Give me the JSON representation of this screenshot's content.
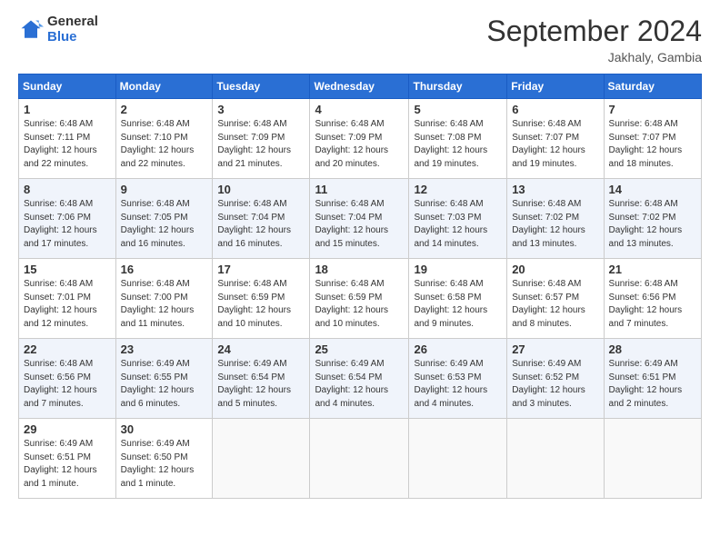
{
  "header": {
    "logo_general": "General",
    "logo_blue": "Blue",
    "month_title": "September 2024",
    "location": "Jakhaly, Gambia"
  },
  "weekdays": [
    "Sunday",
    "Monday",
    "Tuesday",
    "Wednesday",
    "Thursday",
    "Friday",
    "Saturday"
  ],
  "weeks": [
    [
      {
        "day": "1",
        "sunrise": "Sunrise: 6:48 AM",
        "sunset": "Sunset: 7:11 PM",
        "daylight": "Daylight: 12 hours and 22 minutes."
      },
      {
        "day": "2",
        "sunrise": "Sunrise: 6:48 AM",
        "sunset": "Sunset: 7:10 PM",
        "daylight": "Daylight: 12 hours and 22 minutes."
      },
      {
        "day": "3",
        "sunrise": "Sunrise: 6:48 AM",
        "sunset": "Sunset: 7:09 PM",
        "daylight": "Daylight: 12 hours and 21 minutes."
      },
      {
        "day": "4",
        "sunrise": "Sunrise: 6:48 AM",
        "sunset": "Sunset: 7:09 PM",
        "daylight": "Daylight: 12 hours and 20 minutes."
      },
      {
        "day": "5",
        "sunrise": "Sunrise: 6:48 AM",
        "sunset": "Sunset: 7:08 PM",
        "daylight": "Daylight: 12 hours and 19 minutes."
      },
      {
        "day": "6",
        "sunrise": "Sunrise: 6:48 AM",
        "sunset": "Sunset: 7:07 PM",
        "daylight": "Daylight: 12 hours and 19 minutes."
      },
      {
        "day": "7",
        "sunrise": "Sunrise: 6:48 AM",
        "sunset": "Sunset: 7:07 PM",
        "daylight": "Daylight: 12 hours and 18 minutes."
      }
    ],
    [
      {
        "day": "8",
        "sunrise": "Sunrise: 6:48 AM",
        "sunset": "Sunset: 7:06 PM",
        "daylight": "Daylight: 12 hours and 17 minutes."
      },
      {
        "day": "9",
        "sunrise": "Sunrise: 6:48 AM",
        "sunset": "Sunset: 7:05 PM",
        "daylight": "Daylight: 12 hours and 16 minutes."
      },
      {
        "day": "10",
        "sunrise": "Sunrise: 6:48 AM",
        "sunset": "Sunset: 7:04 PM",
        "daylight": "Daylight: 12 hours and 16 minutes."
      },
      {
        "day": "11",
        "sunrise": "Sunrise: 6:48 AM",
        "sunset": "Sunset: 7:04 PM",
        "daylight": "Daylight: 12 hours and 15 minutes."
      },
      {
        "day": "12",
        "sunrise": "Sunrise: 6:48 AM",
        "sunset": "Sunset: 7:03 PM",
        "daylight": "Daylight: 12 hours and 14 minutes."
      },
      {
        "day": "13",
        "sunrise": "Sunrise: 6:48 AM",
        "sunset": "Sunset: 7:02 PM",
        "daylight": "Daylight: 12 hours and 13 minutes."
      },
      {
        "day": "14",
        "sunrise": "Sunrise: 6:48 AM",
        "sunset": "Sunset: 7:02 PM",
        "daylight": "Daylight: 12 hours and 13 minutes."
      }
    ],
    [
      {
        "day": "15",
        "sunrise": "Sunrise: 6:48 AM",
        "sunset": "Sunset: 7:01 PM",
        "daylight": "Daylight: 12 hours and 12 minutes."
      },
      {
        "day": "16",
        "sunrise": "Sunrise: 6:48 AM",
        "sunset": "Sunset: 7:00 PM",
        "daylight": "Daylight: 12 hours and 11 minutes."
      },
      {
        "day": "17",
        "sunrise": "Sunrise: 6:48 AM",
        "sunset": "Sunset: 6:59 PM",
        "daylight": "Daylight: 12 hours and 10 minutes."
      },
      {
        "day": "18",
        "sunrise": "Sunrise: 6:48 AM",
        "sunset": "Sunset: 6:59 PM",
        "daylight": "Daylight: 12 hours and 10 minutes."
      },
      {
        "day": "19",
        "sunrise": "Sunrise: 6:48 AM",
        "sunset": "Sunset: 6:58 PM",
        "daylight": "Daylight: 12 hours and 9 minutes."
      },
      {
        "day": "20",
        "sunrise": "Sunrise: 6:48 AM",
        "sunset": "Sunset: 6:57 PM",
        "daylight": "Daylight: 12 hours and 8 minutes."
      },
      {
        "day": "21",
        "sunrise": "Sunrise: 6:48 AM",
        "sunset": "Sunset: 6:56 PM",
        "daylight": "Daylight: 12 hours and 7 minutes."
      }
    ],
    [
      {
        "day": "22",
        "sunrise": "Sunrise: 6:48 AM",
        "sunset": "Sunset: 6:56 PM",
        "daylight": "Daylight: 12 hours and 7 minutes."
      },
      {
        "day": "23",
        "sunrise": "Sunrise: 6:49 AM",
        "sunset": "Sunset: 6:55 PM",
        "daylight": "Daylight: 12 hours and 6 minutes."
      },
      {
        "day": "24",
        "sunrise": "Sunrise: 6:49 AM",
        "sunset": "Sunset: 6:54 PM",
        "daylight": "Daylight: 12 hours and 5 minutes."
      },
      {
        "day": "25",
        "sunrise": "Sunrise: 6:49 AM",
        "sunset": "Sunset: 6:54 PM",
        "daylight": "Daylight: 12 hours and 4 minutes."
      },
      {
        "day": "26",
        "sunrise": "Sunrise: 6:49 AM",
        "sunset": "Sunset: 6:53 PM",
        "daylight": "Daylight: 12 hours and 4 minutes."
      },
      {
        "day": "27",
        "sunrise": "Sunrise: 6:49 AM",
        "sunset": "Sunset: 6:52 PM",
        "daylight": "Daylight: 12 hours and 3 minutes."
      },
      {
        "day": "28",
        "sunrise": "Sunrise: 6:49 AM",
        "sunset": "Sunset: 6:51 PM",
        "daylight": "Daylight: 12 hours and 2 minutes."
      }
    ],
    [
      {
        "day": "29",
        "sunrise": "Sunrise: 6:49 AM",
        "sunset": "Sunset: 6:51 PM",
        "daylight": "Daylight: 12 hours and 1 minute."
      },
      {
        "day": "30",
        "sunrise": "Sunrise: 6:49 AM",
        "sunset": "Sunset: 6:50 PM",
        "daylight": "Daylight: 12 hours and 1 minute."
      },
      null,
      null,
      null,
      null,
      null
    ]
  ]
}
